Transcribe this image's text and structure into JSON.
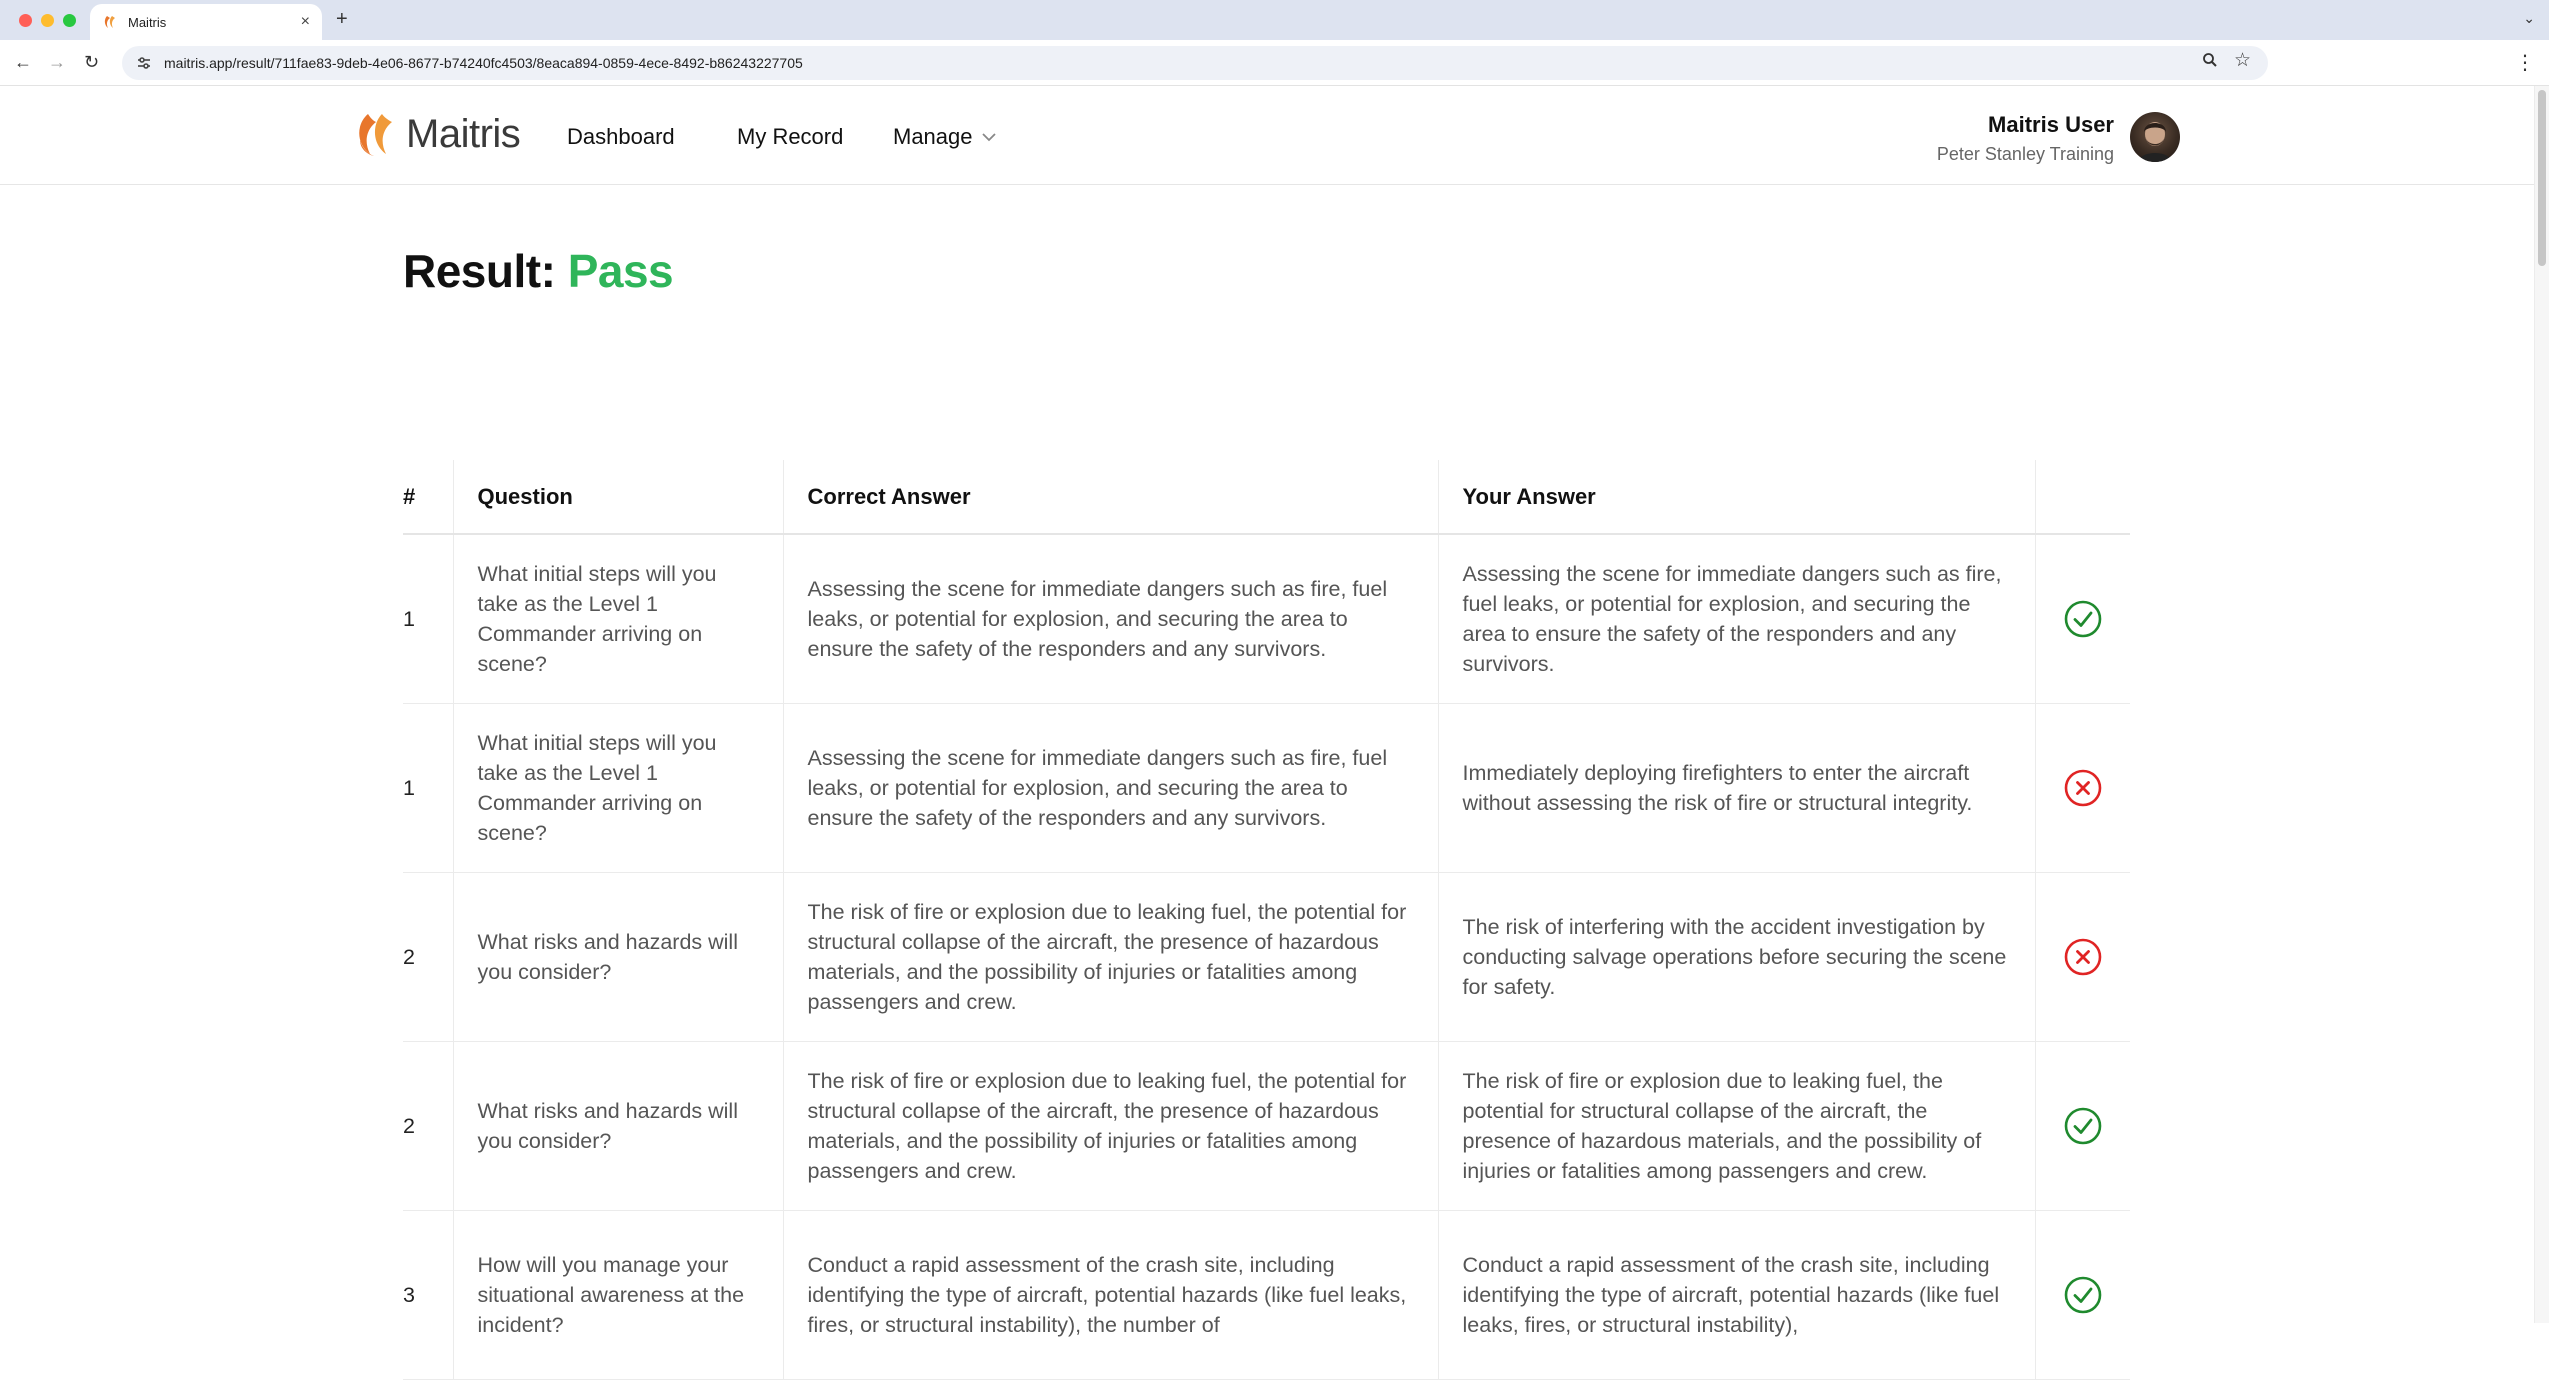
{
  "browser": {
    "tab_title": "Maitris",
    "url": "maitris.app/result/711fae83-9deb-4e06-8677-b74240fc4503/8eaca894-0859-4ece-8492-b86243227705"
  },
  "header": {
    "logo_text": "Maitris",
    "nav": {
      "dashboard": "Dashboard",
      "my_record": "My Record",
      "manage": "Manage"
    },
    "user": {
      "name": "Maitris User",
      "org": "Peter Stanley Training"
    }
  },
  "result": {
    "label": "Result:",
    "value": "Pass",
    "value_color": "#2fb55a"
  },
  "table": {
    "headers": {
      "num": "#",
      "question": "Question",
      "correct": "Correct Answer",
      "yours": "Your Answer"
    },
    "rows": [
      {
        "num": "1",
        "question": "What initial steps will you take as the Level 1 Commander arriving on scene?",
        "correct": "Assessing the scene for immediate dangers such as fire, fuel leaks, or potential for explosion, and securing the area to ensure the safety of the responders and any survivors.",
        "yours": "Assessing the scene for immediate dangers such as fire, fuel leaks, or potential for explosion, and securing the area to ensure the safety of the responders and any survivors.",
        "status": "correct"
      },
      {
        "num": "1",
        "question": "What initial steps will you take as the Level 1 Commander arriving on scene?",
        "correct": "Assessing the scene for immediate dangers such as fire, fuel leaks, or potential for explosion, and securing the area to ensure the safety of the responders and any survivors.",
        "yours": "Immediately deploying firefighters to enter the aircraft without assessing the risk of fire or structural integrity.",
        "status": "incorrect"
      },
      {
        "num": "2",
        "question": "What risks and hazards will you consider?",
        "correct": "The risk of fire or explosion due to leaking fuel, the potential for structural collapse of the aircraft, the presence of hazardous materials, and the possibility of injuries or fatalities among passengers and crew.",
        "yours": "The risk of interfering with the accident investigation by conducting salvage operations before securing the scene for safety.",
        "status": "incorrect"
      },
      {
        "num": "2",
        "question": "What risks and hazards will you consider?",
        "correct": "The risk of fire or explosion due to leaking fuel, the potential for structural collapse of the aircraft, the presence of hazardous materials, and the possibility of injuries or fatalities among passengers and crew.",
        "yours": "The risk of fire or explosion due to leaking fuel, the potential for structural collapse of the aircraft, the presence of hazardous materials, and the possibility of injuries or fatalities among passengers and crew.",
        "status": "correct"
      },
      {
        "num": "3",
        "question": "How will you manage your situational awareness at the incident?",
        "correct": "Conduct a rapid assessment of the crash site, including identifying the type of aircraft, potential hazards (like fuel leaks, fires, or structural instability), the number of",
        "yours": "Conduct a rapid assessment of the crash site, including identifying the type of aircraft, potential hazards (like fuel leaks, fires, or structural instability),",
        "status": "correct"
      }
    ]
  },
  "colors": {
    "correct": "#1f8a2e",
    "incorrect": "#e02424",
    "brand_orange": "#e8762c"
  },
  "icons": {
    "correct": "check-circle-icon",
    "incorrect": "x-circle-icon"
  }
}
